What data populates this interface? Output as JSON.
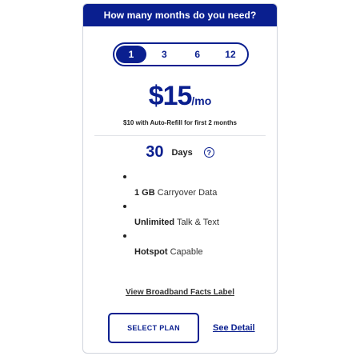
{
  "header": {
    "title": "How many months do you need?"
  },
  "months": {
    "options": [
      "1",
      "3",
      "6",
      "12"
    ],
    "selected": "1"
  },
  "price": {
    "amount": "$15",
    "period": "/mo"
  },
  "autorefill": "$10 with Auto-Refill for first 2 months",
  "days": {
    "number": "30",
    "label": "Days",
    "help_icon": "?"
  },
  "features": [
    {
      "bold": "1 GB",
      "rest": " Carryover Data"
    },
    {
      "bold": "Unlimited",
      "rest": " Talk & Text"
    },
    {
      "bold": "Hotspot",
      "rest": " Capable"
    }
  ],
  "broadband_link": "View Broadband Facts Label",
  "select_plan": "SELECT PLAN",
  "see_detail": "See Detail",
  "colors": {
    "brand": "#0a1f8f"
  }
}
